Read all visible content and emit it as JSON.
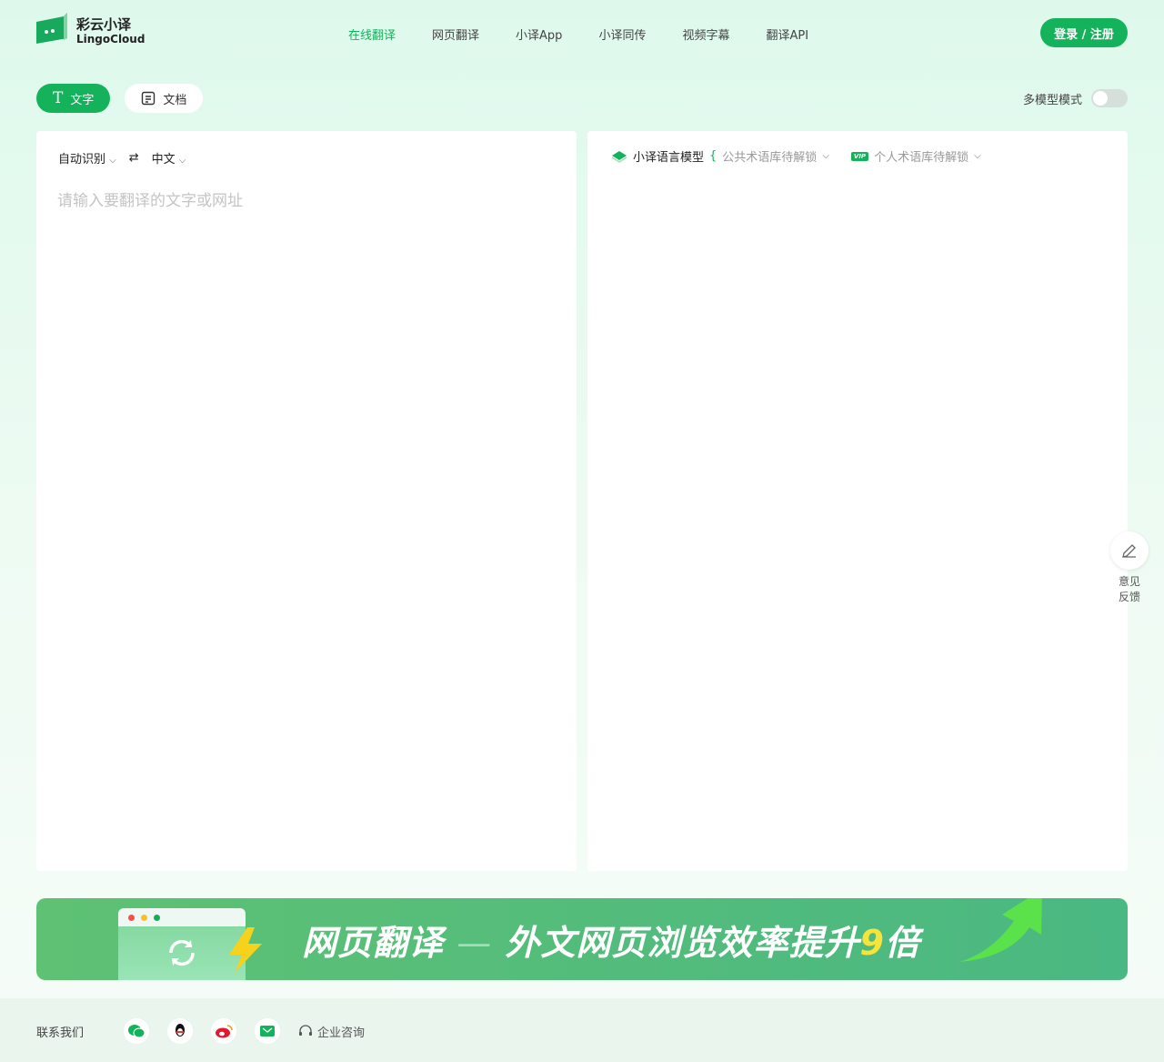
{
  "header": {
    "logo_cn": "彩云小译",
    "logo_en": "LingoCloud",
    "nav": [
      "在线翻译",
      "网页翻译",
      "小译App",
      "小译同传",
      "视频字幕",
      "翻译API"
    ],
    "login": "登录 / 注册"
  },
  "modes": {
    "text": "文字",
    "doc": "文档",
    "multi_model": "多模型模式"
  },
  "source": {
    "from": "自动识别",
    "to": "中文",
    "placeholder": "请输入要翻译的文字或网址"
  },
  "target": {
    "model": "小译语言模型",
    "public_glossary": "公共术语库待解锁",
    "vip": "VIP",
    "personal_glossary": "个人术语库待解锁"
  },
  "feedback": {
    "line1": "意见",
    "line2": "反馈"
  },
  "banner": {
    "title": "网页翻译",
    "dash": "—",
    "slogan": "外文网页浏览效率提升",
    "nine": "9",
    "tail": "倍"
  },
  "footer": {
    "contact": "联系我们",
    "consult": "企业咨询"
  },
  "colors": {
    "brand": "#13b25b"
  }
}
